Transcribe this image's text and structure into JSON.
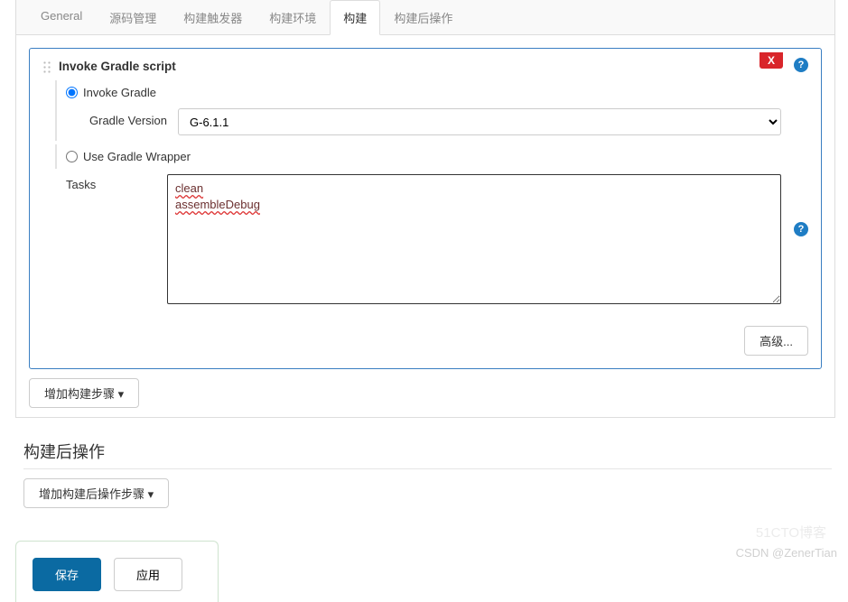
{
  "tabs": [
    "General",
    "源码管理",
    "构建触发器",
    "构建环境",
    "构建",
    "构建后操作"
  ],
  "activeTabIndex": 4,
  "build": {
    "title": "Invoke Gradle script",
    "closeLabel": "X",
    "radioInvoke": "Invoke Gradle",
    "radioWrapper": "Use Gradle Wrapper",
    "versionLabel": "Gradle Version",
    "versionValue": "G-6.1.1",
    "tasksLabel": "Tasks",
    "tasksValue": "clean\nassembleDebug",
    "advancedLabel": "高级..."
  },
  "addBuildStep": "增加构建步骤 ▾",
  "postSection": "构建后操作",
  "addPostStep": "增加构建后操作步骤 ▾",
  "saveLabel": "保存",
  "applyLabel": "应用",
  "watermark": "CSDN @ZenerTian",
  "watermark2": "51CTO博客"
}
